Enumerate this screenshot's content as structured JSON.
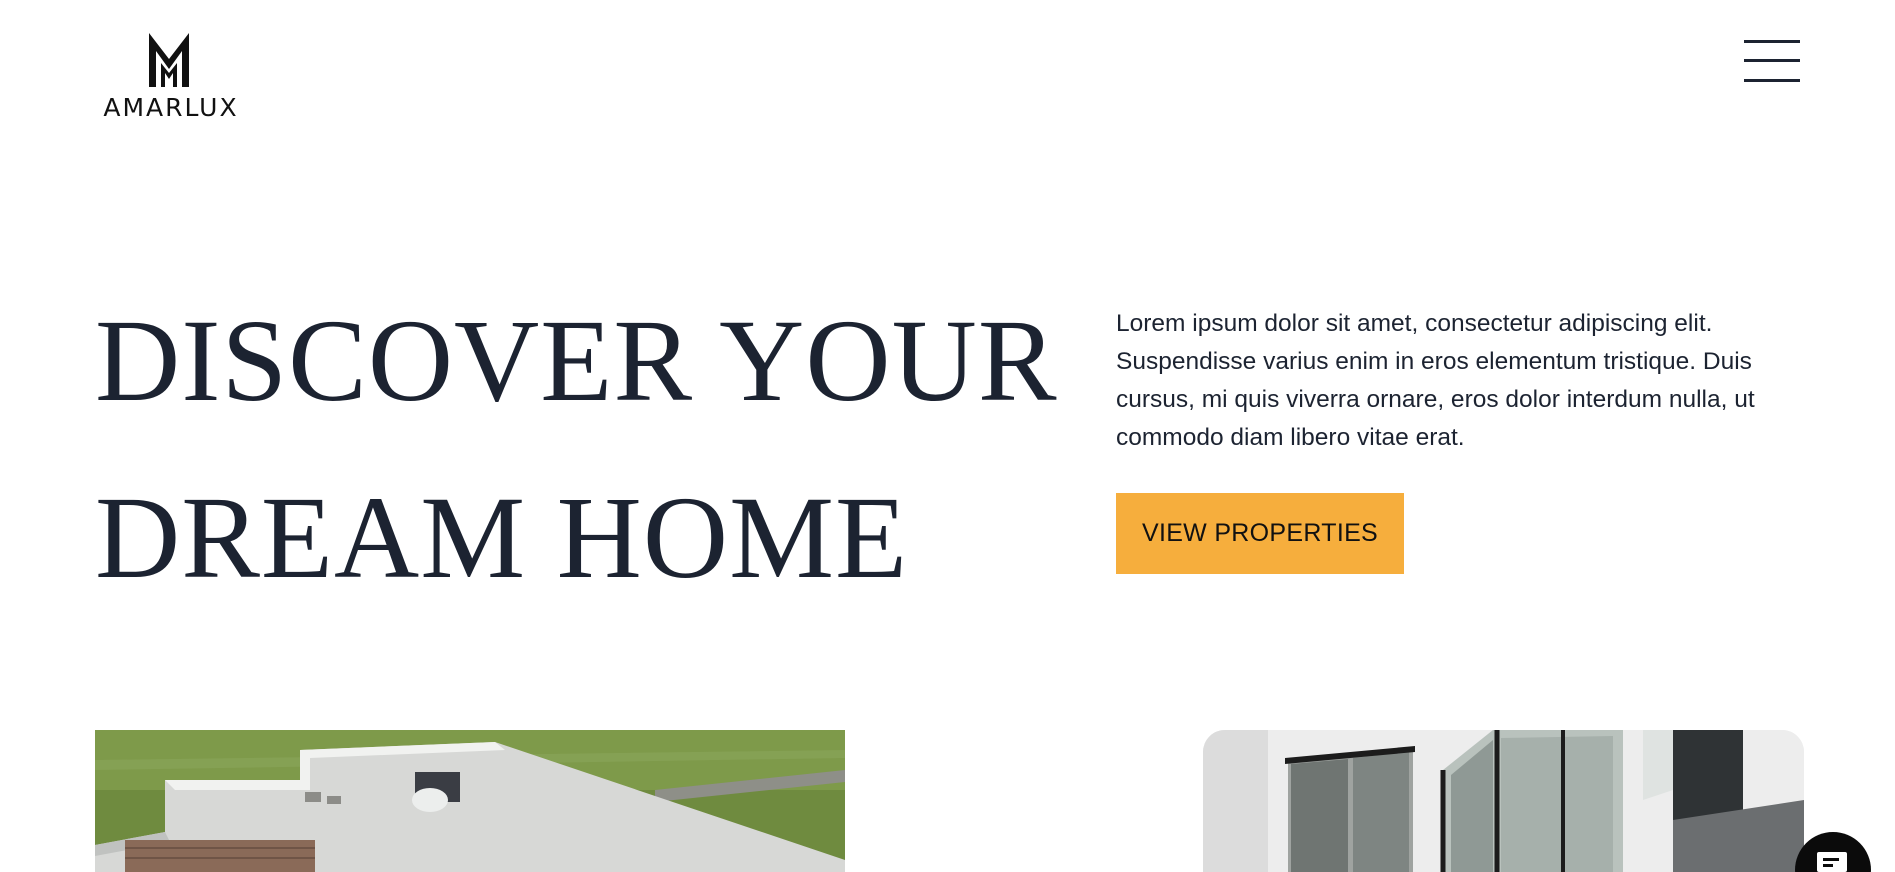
{
  "header": {
    "logo_text": "AMARLUX",
    "menu_icon": "hamburger-menu-icon"
  },
  "hero": {
    "title_line1": "DISCOVER YOUR",
    "title_line2": "DREAM HOME",
    "description": "Lorem ipsum dolor sit amet, consectetur adipiscing elit. Suspendisse varius enim in eros elementum tristique. Duis cursus, mi quis viverra ornare, eros dolor interdum nulla, ut commodo diam libero vitae erat.",
    "cta_label": "VIEW PROPERTIES"
  },
  "gallery": {
    "left_image": "aerial-house-rooftop-image",
    "right_image": "modern-house-glass-facade-image"
  },
  "chat": {
    "icon": "chat-bubble-icon"
  },
  "colors": {
    "accent": "#f6ae3d",
    "text": "#1c2331",
    "background": "#ffffff"
  }
}
